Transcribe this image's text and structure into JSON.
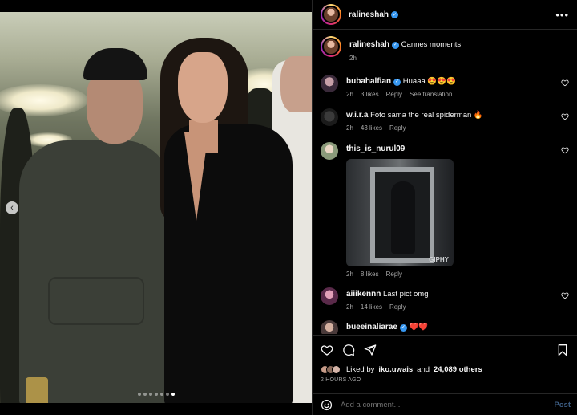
{
  "post": {
    "username": "ralineshah",
    "photo": {
      "dots_total": 7,
      "active_dot": 6
    }
  },
  "header": {
    "username": "ralineshah",
    "more_icon": "more-horizontal-icon"
  },
  "caption": {
    "username": "ralineshah",
    "text": "Cannes moments",
    "time": "2h"
  },
  "comments": [
    {
      "username": "bubahalfian",
      "verified": true,
      "text": "Huaaa 😍😍😍",
      "time": "2h",
      "likes": "3 likes",
      "reply": "Reply",
      "extra": "See translation"
    },
    {
      "username": "w.i.r.a",
      "verified": false,
      "text": "Foto sama the real spiderman 🔥",
      "time": "2h",
      "likes": "43 likes",
      "reply": "Reply"
    },
    {
      "username": "this_is_nurul09",
      "verified": false,
      "text": "",
      "time": "2h",
      "likes": "8 likes",
      "reply": "Reply",
      "gif_tag": "GIPHY"
    },
    {
      "username": "aiiikennn",
      "verified": false,
      "text": "Last pict omg",
      "time": "2h",
      "likes": "14 likes",
      "reply": "Reply"
    },
    {
      "username": "bueeinaliarae",
      "verified": true,
      "text": "❤️❤️",
      "time": "",
      "likes": "",
      "reply": ""
    }
  ],
  "actions": {
    "liked_by_prefix": "Liked by",
    "liked_by_user": "iko.uwais",
    "liked_by_and": "and",
    "liked_by_count": "24,089 others",
    "time": "2 HOURS AGO"
  },
  "add_comment": {
    "placeholder": "Add a comment...",
    "post_label": "Post"
  },
  "colors": {
    "verified": "#3797f0",
    "post_button": "#3b5b80",
    "background": "#000000"
  }
}
